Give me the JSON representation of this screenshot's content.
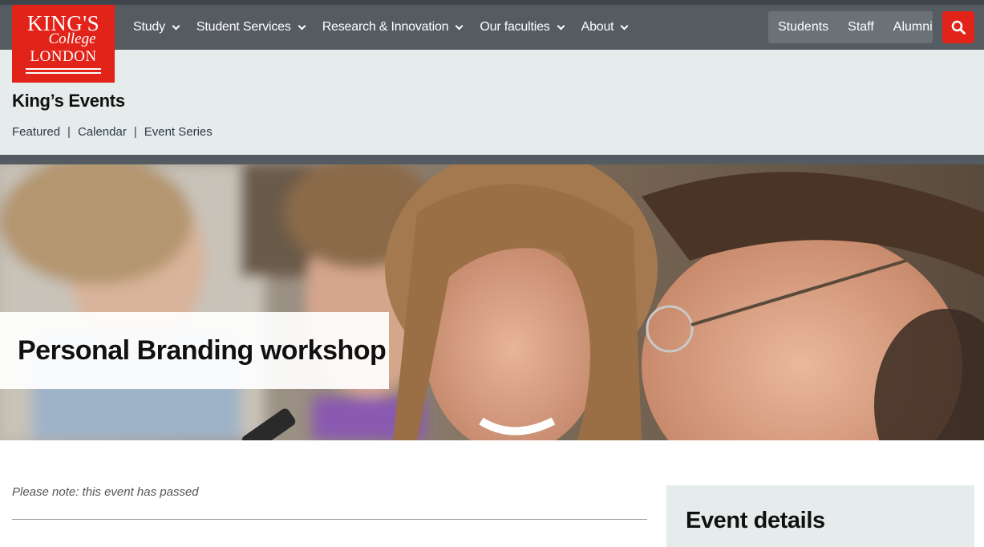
{
  "logo": {
    "line1": "KING'S",
    "line2": "College",
    "line3": "LONDON"
  },
  "nav": {
    "items": [
      {
        "label": "Study"
      },
      {
        "label": "Student Services"
      },
      {
        "label": "Research & Innovation"
      },
      {
        "label": "Our faculties"
      },
      {
        "label": "About"
      }
    ],
    "audience": [
      {
        "label": "Students"
      },
      {
        "label": "Staff"
      },
      {
        "label": "Alumni"
      }
    ],
    "search_icon": "search-icon"
  },
  "site": {
    "title": "King’s Events",
    "subnav": [
      {
        "label": "Featured"
      },
      {
        "label": "Calendar"
      },
      {
        "label": "Event Series"
      }
    ]
  },
  "event": {
    "title": "Personal Branding workshop",
    "notice": "Please note: this event has passed",
    "details_heading": "Event details"
  },
  "colors": {
    "brand_red": "#e2231a",
    "nav_bg": "#545b61",
    "subheader_bg": "#e6ebec"
  }
}
